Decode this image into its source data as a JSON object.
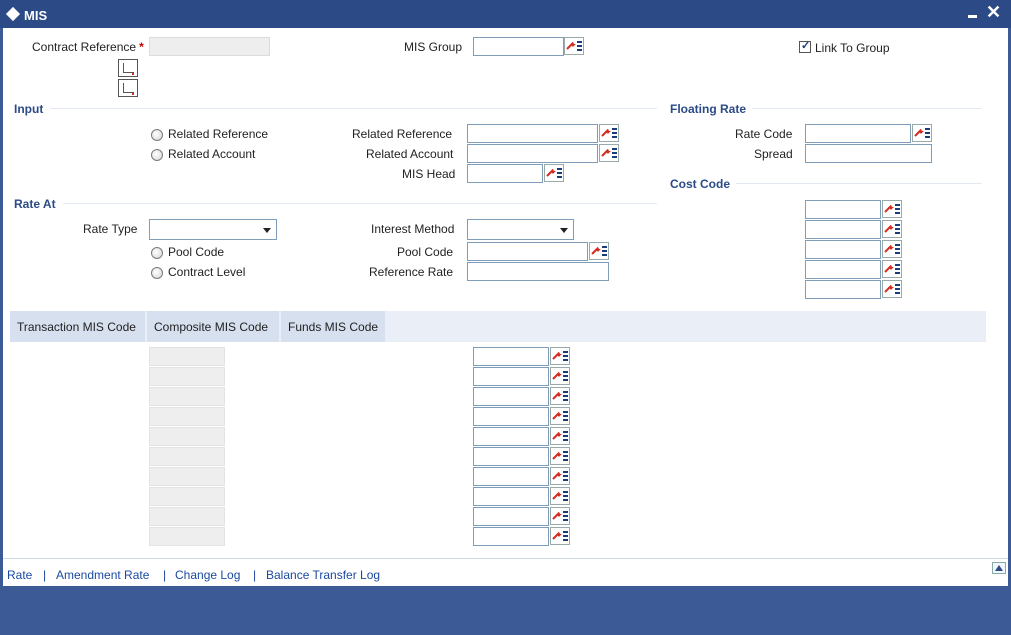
{
  "window": {
    "title": "MIS"
  },
  "header": {
    "contract_reference_label": "Contract Reference",
    "required_mark": "*",
    "mis_group_label": "MIS Group",
    "link_to_group_label": "Link To Group",
    "link_to_group_checked": true
  },
  "input_section": {
    "title": "Input",
    "radio_related_reference": "Related Reference",
    "radio_related_account": "Related Account",
    "related_reference_label": "Related Reference",
    "related_account_label": "Related Account",
    "mis_head_label": "MIS Head"
  },
  "floating_rate": {
    "title": "Floating Rate",
    "rate_code_label": "Rate Code",
    "spread_label": "Spread"
  },
  "cost_code": {
    "title": "Cost Code",
    "count": 5
  },
  "rate_at": {
    "title": "Rate At",
    "rate_type_label": "Rate Type",
    "interest_method_label": "Interest Method",
    "radio_pool_code": "Pool Code",
    "radio_contract_level": "Contract Level",
    "pool_code_label": "Pool Code",
    "reference_rate_label": "Reference Rate"
  },
  "tabs": [
    {
      "label": "Transaction MIS Code"
    },
    {
      "label": "Composite MIS Code"
    },
    {
      "label": "Funds MIS Code"
    }
  ],
  "grid": {
    "rows": 10
  },
  "footer": {
    "links": [
      {
        "label": "Rate"
      },
      {
        "label": "Amendment Rate"
      },
      {
        "label": "Change Log"
      },
      {
        "label": "Balance Transfer Log"
      }
    ],
    "separator": "|"
  },
  "colors": {
    "titlebar": "#2b4a86",
    "section_title": "#2b4a86",
    "link": "#1a4aa0",
    "required": "#cc0000"
  }
}
